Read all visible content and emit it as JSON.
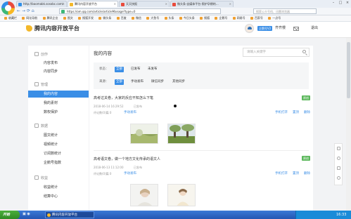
{
  "browser": {
    "tabs": [
      {
        "label": "http://baomabk.sosobc.com/",
        "active": false
      },
      {
        "label": "腾讯内容开放平台",
        "active": true
      },
      {
        "label": "天天快报",
        "active": false
      },
      {
        "label": "微头条·自媒体平台-照护孕期的…",
        "active": false
      }
    ],
    "url": "https://om.qq.com/article/articleManage?type=0",
    "search_placeholder": "搜索公众号机、迅雷浏览器",
    "window_buttons": [
      "–",
      "□",
      "×"
    ],
    "nav_buttons": [
      "←",
      "→",
      "⟳",
      "⌂"
    ],
    "bookmarks": [
      "收藏栏",
      "网址导航",
      "腾讯企业",
      "图文",
      "搜狐开发",
      "微头条",
      "百度",
      "微信",
      "大鱼号",
      "头条",
      "今日头条",
      "搜狐",
      "企鹅号",
      "网易号",
      "百家号",
      "一点号"
    ]
  },
  "header": {
    "site_name": "腾讯内容开放平台",
    "vip_label": "企鹅号V2",
    "username": "齐齐慢",
    "logout": "退出"
  },
  "sidebar": {
    "groups": [
      {
        "label": "创作",
        "items": [
          "内容发布",
          "内容同步"
        ]
      },
      {
        "label": "管理",
        "items": [
          "我的内容",
          "我的素材",
          "数权保护"
        ]
      },
      {
        "label": "数据",
        "items": [
          "图文统计",
          "视频统计",
          "订阅数统计",
          "企鹅号指数"
        ]
      },
      {
        "label": "收益",
        "items": [
          "收益统计",
          "结算中心"
        ]
      }
    ],
    "active_item": "我的内容"
  },
  "main": {
    "title": "我的内容",
    "search_placeholder": "请输入关键字",
    "filters": {
      "status_label": "状态：",
      "status_options": [
        "全部",
        "已发布",
        "未发布"
      ],
      "source_label": "来源：",
      "source_options": [
        "全部",
        "手动发布",
        "微信同步",
        "其他同步"
      ]
    },
    "articles": [
      {
        "title": "高考过关卷，大家的反应不知怎么下笔",
        "badge": "原创",
        "datetime": "2018-06-14 16:29:52",
        "status": "已发布",
        "comments": "评论数(0)篇 0",
        "source": "手动发布",
        "actions": [
          "手机打开",
          "置顶",
          "删除"
        ]
      },
      {
        "title": "高考语文卷，做一个地方文化传承的语文人",
        "badge": "原创",
        "datetime": "2018-06-13 11:12:00",
        "status": "已发布",
        "comments": "评论数(0)篇 0",
        "source": "手动发布",
        "actions": [
          "手机打开",
          "置顶",
          "删除"
        ]
      }
    ]
  },
  "taskbar": {
    "start": "开始",
    "task": "腾讯内容开放平台",
    "clock": "16:33"
  },
  "colors": {
    "accent": "#3a8ee6",
    "badge_green": "#5cb85c",
    "logo_yellow": "#f3b82b"
  }
}
